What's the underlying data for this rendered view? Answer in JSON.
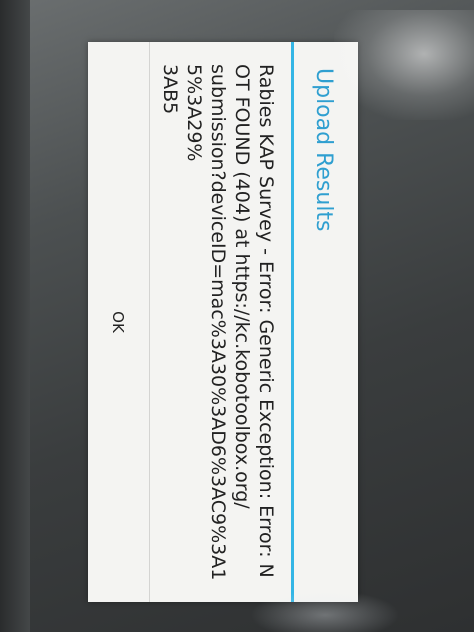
{
  "dialog": {
    "title": "Upload Results",
    "message": "Rabies KAP Survey - Error: Generic Exception: Error: NOT FOUND (404) at https://kc.kobotoolbox.org/\nsubmission?deviceID=mac%3A30%3AD6%3AC9%3A15%3A29%\n3AB5",
    "ok_label": "OK"
  },
  "colors": {
    "title": "#2f9fd0",
    "rule": "#33b5e5",
    "dialog_bg": "#f4f4f2"
  }
}
